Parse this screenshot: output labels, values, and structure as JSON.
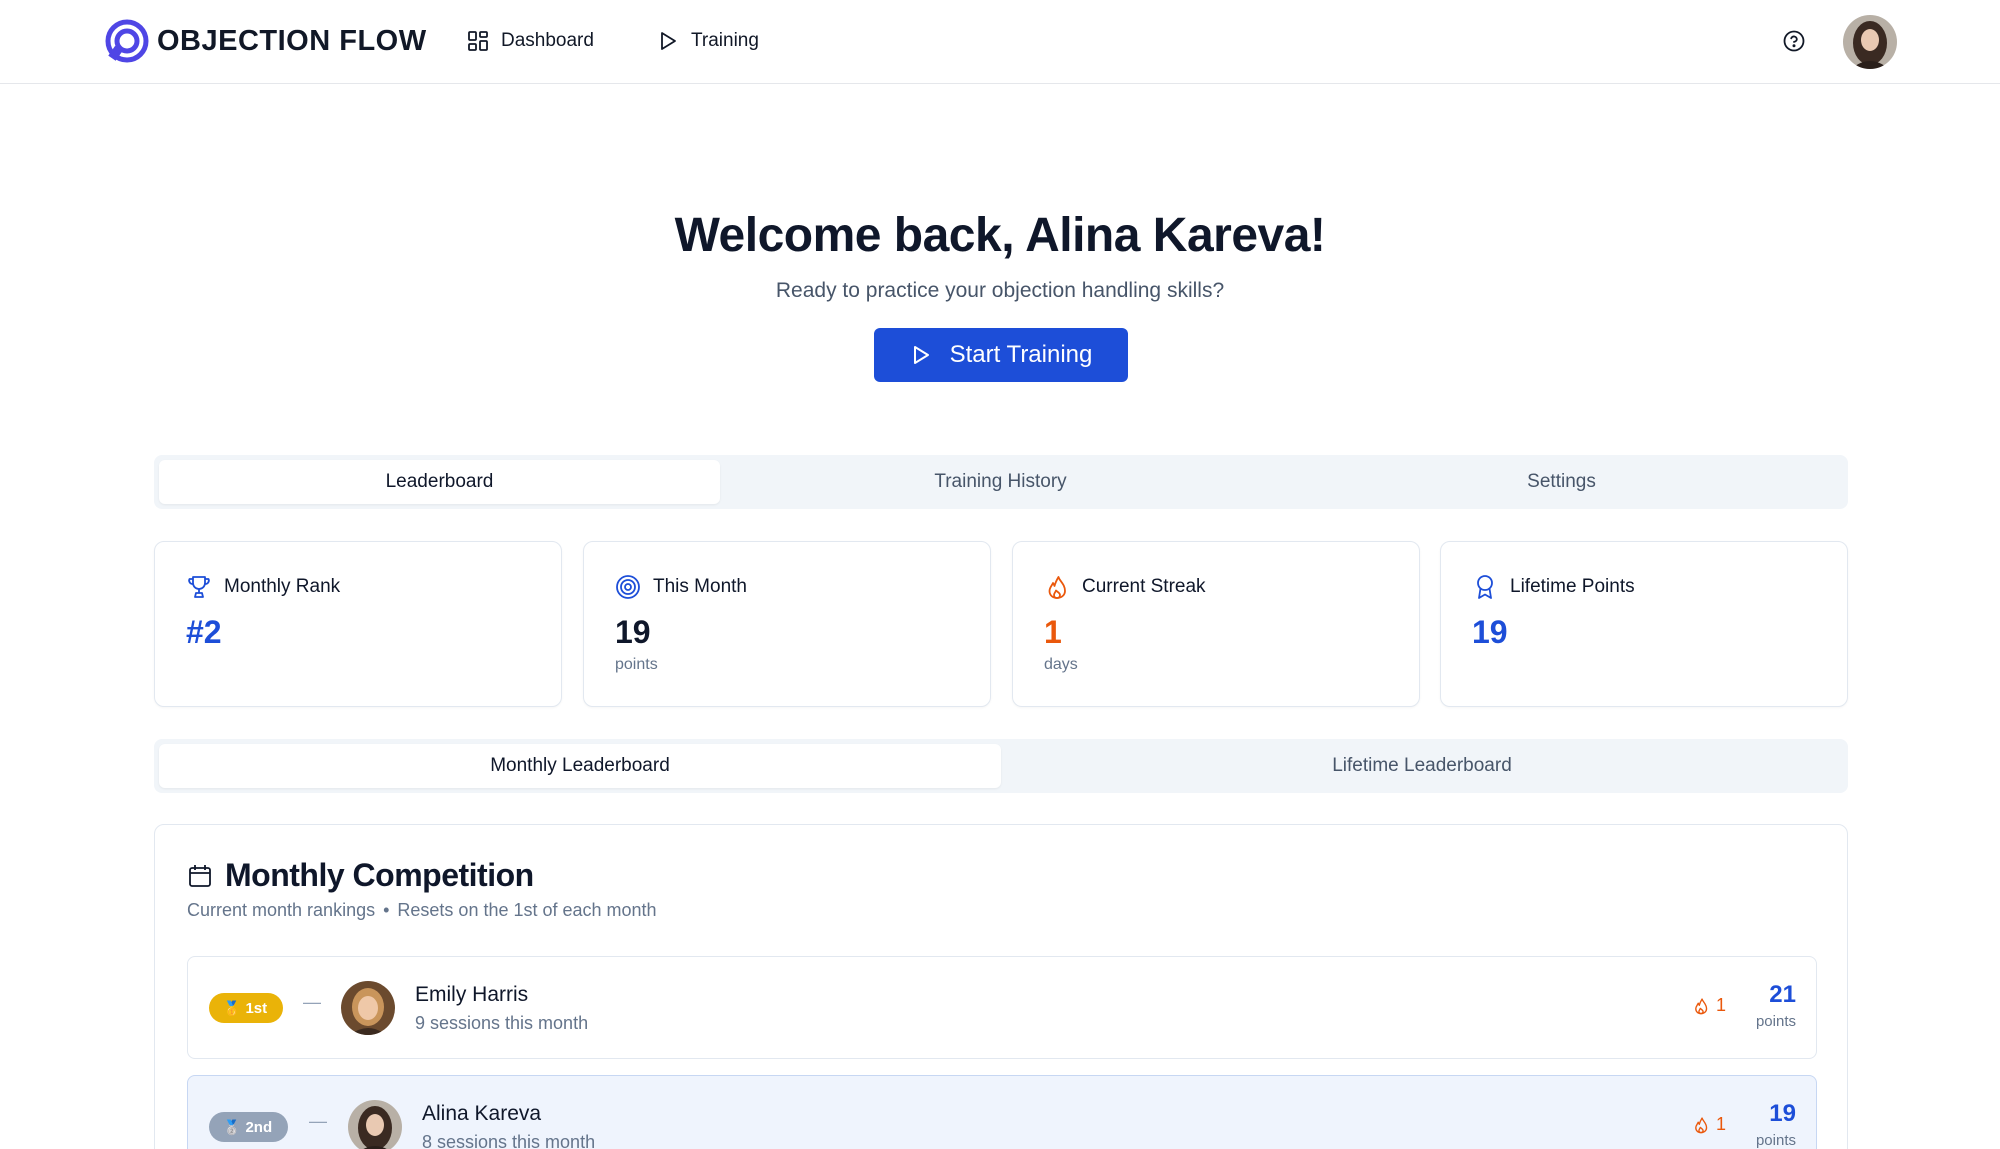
{
  "brand": {
    "name": "OBJECTION FLOW",
    "accent": "#1d4ed8"
  },
  "nav": {
    "dashboard": "Dashboard",
    "training": "Training"
  },
  "hero": {
    "title": "Welcome back, Alina Kareva!",
    "subtitle": "Ready to practice your objection handling skills?",
    "cta": "Start Training"
  },
  "main_tabs": [
    "Leaderboard",
    "Training History",
    "Settings"
  ],
  "stats": [
    {
      "label": "Monthly Rank",
      "value": "#2",
      "unit": "",
      "icon": "trophy-icon"
    },
    {
      "label": "This Month",
      "value": "19",
      "unit": "points",
      "icon": "target-icon"
    },
    {
      "label": "Current Streak",
      "value": "1",
      "unit": "days",
      "icon": "flame-icon"
    },
    {
      "label": "Lifetime Points",
      "value": "19",
      "unit": "",
      "icon": "award-icon"
    }
  ],
  "leaderboard_tabs": [
    "Monthly Leaderboard",
    "Lifetime Leaderboard"
  ],
  "competition": {
    "title": "Monthly Competition",
    "subtitle_a": "Current month rankings",
    "separator": "•",
    "subtitle_b": "Resets on the 1st of each month",
    "rows": [
      {
        "rank": "1st",
        "trend": "—",
        "name": "Emily Harris",
        "sessions": "9 sessions this month",
        "streak": "1",
        "points": "21",
        "points_label": "points"
      },
      {
        "rank": "2nd",
        "trend": "—",
        "name": "Alina Kareva",
        "sessions": "8 sessions this month",
        "streak": "1",
        "points": "19",
        "points_label": "points"
      }
    ]
  }
}
